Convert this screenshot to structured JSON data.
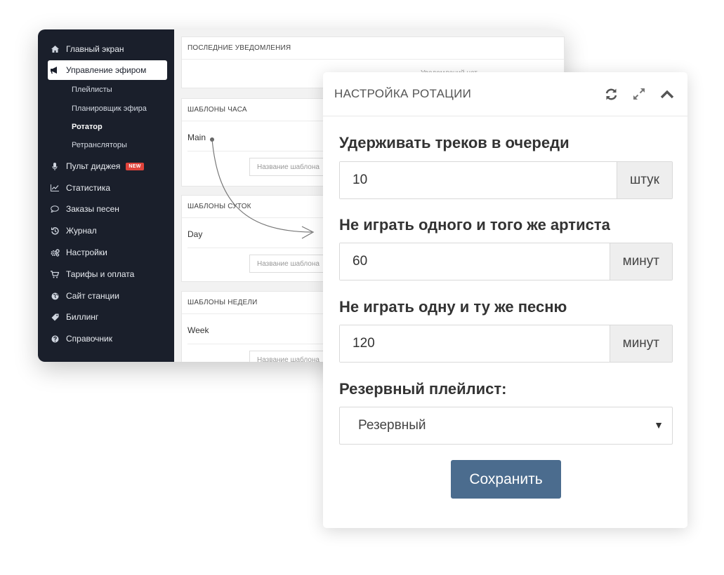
{
  "sidebar": {
    "items": [
      {
        "label": "Главный экран",
        "icon": "home-icon"
      },
      {
        "label": "Управление эфиром",
        "icon": "megaphone-icon"
      },
      {
        "label": "Пульт диджея",
        "icon": "microphone-icon",
        "badge": "NEW"
      },
      {
        "label": "Статистика",
        "icon": "chart-icon"
      },
      {
        "label": "Заказы песен",
        "icon": "chat-icon"
      },
      {
        "label": "Журнал",
        "icon": "history-icon"
      },
      {
        "label": "Настройки",
        "icon": "gears-icon"
      },
      {
        "label": "Тарифы и оплата",
        "icon": "cart-icon"
      },
      {
        "label": "Сайт станции",
        "icon": "globe-icon"
      },
      {
        "label": "Биллинг",
        "icon": "tag-icon"
      },
      {
        "label": "Справочник",
        "icon": "question-icon"
      }
    ],
    "subitems": [
      {
        "label": "Плейлисты"
      },
      {
        "label": "Планировщик эфира"
      },
      {
        "label": "Ротатор"
      },
      {
        "label": "Ретрансляторы"
      }
    ]
  },
  "cards": {
    "notifications": {
      "title": "ПОСЛЕДНИЕ УВЕДОМЛЕНИЯ",
      "text": "Уведомлений нет"
    },
    "hour": {
      "title": "ШАБЛОНЫ ЧАСА",
      "row": "Main",
      "placeholder": "Название шаблона"
    },
    "day": {
      "title": "ШАБЛОНЫ СУТОК",
      "row": "Day",
      "placeholder": "Название шаблона"
    },
    "week": {
      "title": "ШАБЛОНЫ НЕДЕЛИ",
      "row": "Week",
      "placeholder": "Название шаблона"
    }
  },
  "panel": {
    "title": "НАСТРОЙКА РОТАЦИИ",
    "fields": [
      {
        "label": "Удерживать треков в очереди",
        "value": "10",
        "unit": "штук"
      },
      {
        "label": "Не играть одного и того же артиста",
        "value": "60",
        "unit": "минут"
      },
      {
        "label": "Не играть одну и ту же песню",
        "value": "120",
        "unit": "минут"
      }
    ],
    "playlist_label": "Резервный плейлист:",
    "playlist_value": "Резервный",
    "save_label": "Сохранить"
  },
  "colors": {
    "sidebar_bg": "#1a1f2b",
    "button_bg": "#4b6c8e",
    "badge_bg": "#e0433b"
  }
}
